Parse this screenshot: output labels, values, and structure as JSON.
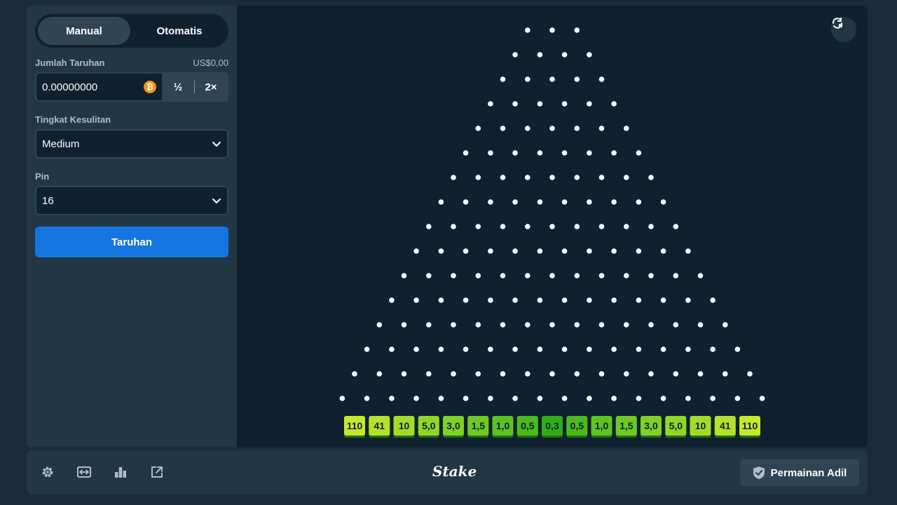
{
  "sidebar": {
    "modes": [
      {
        "label": "Manual",
        "active": true
      },
      {
        "label": "Otomatis",
        "active": false
      }
    ],
    "bet_amount": {
      "label": "Jumlah Taruhan",
      "usd_value": "US$0,00",
      "value": "0.00000000",
      "currency_icon": "bitcoin-icon",
      "half_label": "½",
      "double_label": "2×"
    },
    "difficulty": {
      "label": "Tingkat Kesulitan",
      "value": "Medium"
    },
    "pins": {
      "label": "Pin",
      "value": "16"
    },
    "bet_button_label": "Taruhan"
  },
  "board": {
    "rows": 16,
    "top_row_pegs": 3,
    "peg_color": "#ffffff",
    "multipliers": [
      "110",
      "41",
      "10",
      "5,0",
      "3,0",
      "1,5",
      "1,0",
      "0,5",
      "0,3",
      "0,5",
      "1,0",
      "1,5",
      "3,0",
      "5,0",
      "10",
      "41",
      "110"
    ],
    "bucket_colors": [
      "#c6e82a",
      "#b4e22a",
      "#a3dc28",
      "#91d626",
      "#80d025",
      "#6ec923",
      "#5cc321",
      "#4abb1f",
      "#2fae1a",
      "#4abb1f",
      "#5cc321",
      "#6ec923",
      "#80d025",
      "#91d626",
      "#a3dc28",
      "#b4e22a",
      "#c6e82a"
    ],
    "reload_icon": "refresh-icon"
  },
  "footer": {
    "icons": [
      "settings-icon",
      "theatre-mode-icon",
      "stats-icon",
      "popout-icon"
    ],
    "brand": "Stake",
    "fair_label": "Permainan Adil",
    "fair_icon": "shield-check-icon"
  }
}
